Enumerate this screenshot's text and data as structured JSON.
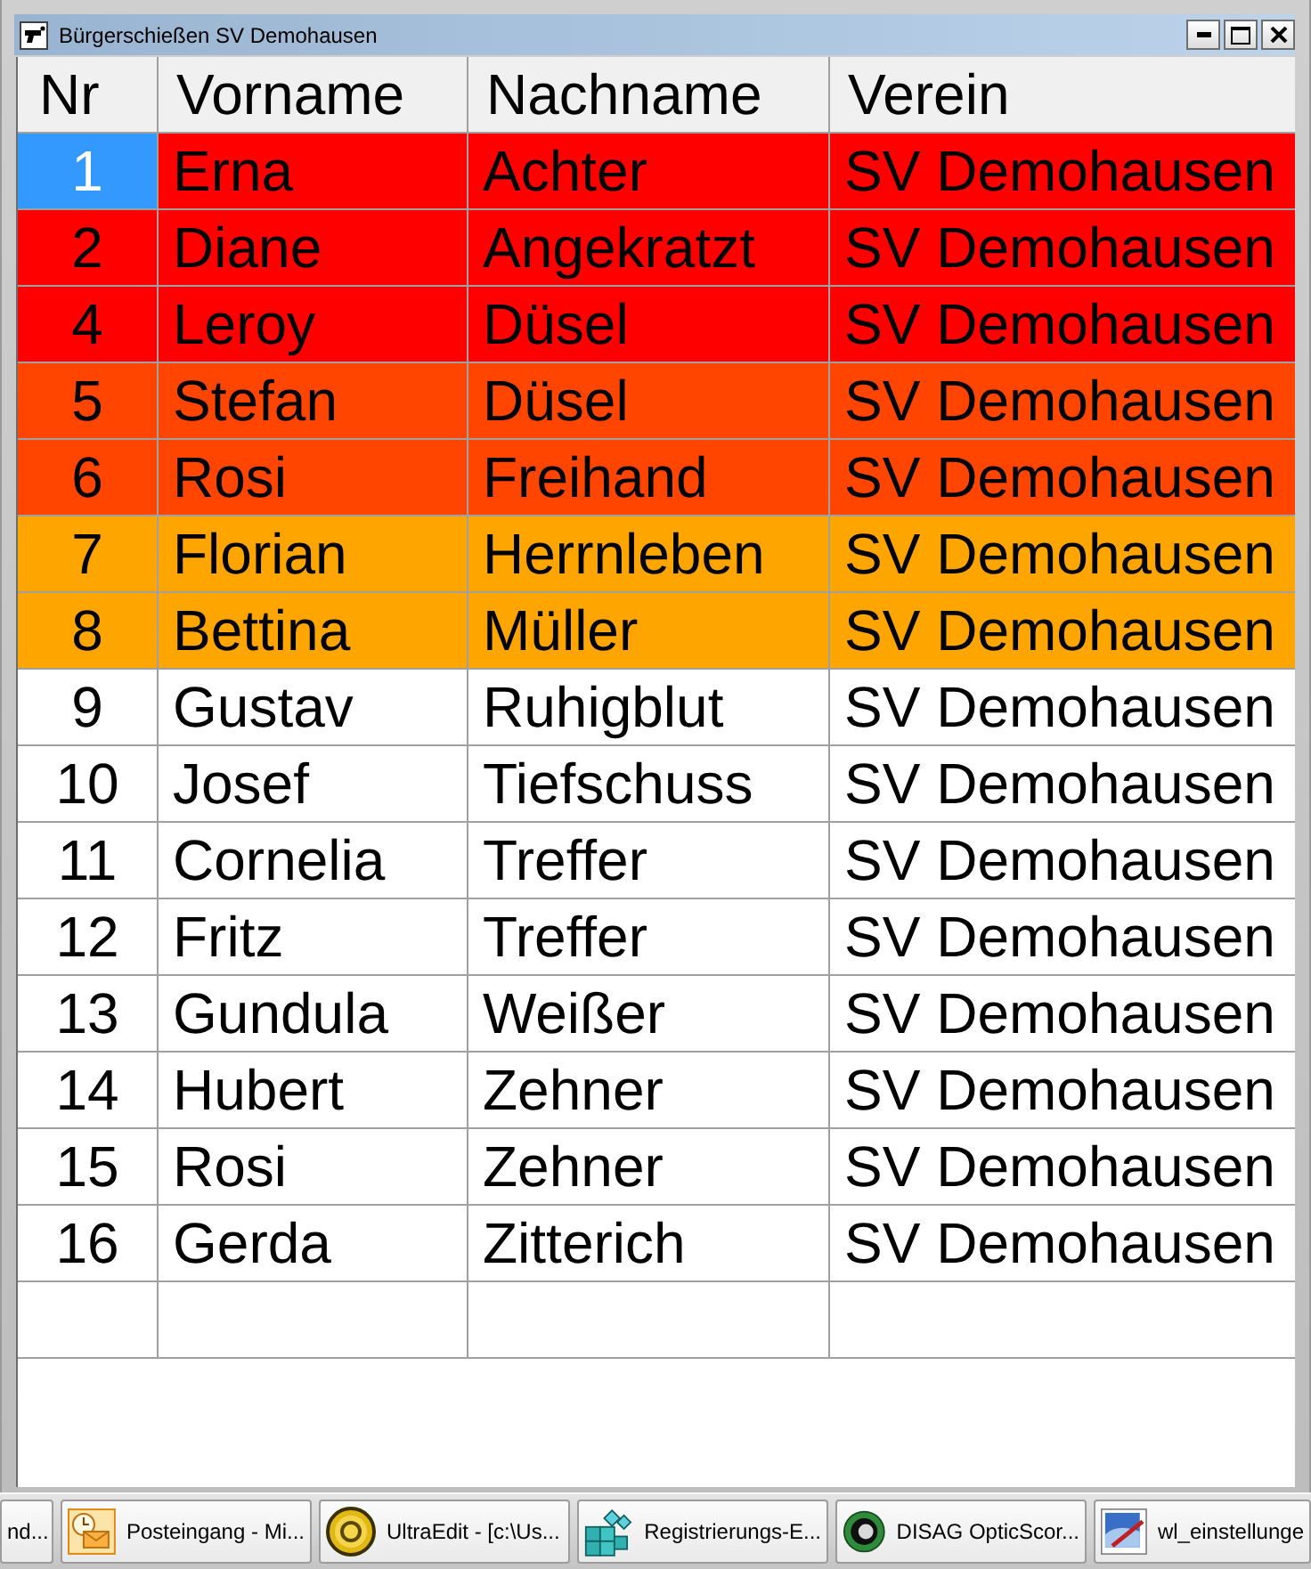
{
  "window": {
    "title": "Bürgerschießen SV Demohausen"
  },
  "table": {
    "columns": [
      "Nr",
      "Vorname",
      "Nachname",
      "Verein"
    ],
    "rows": [
      {
        "nr": "1",
        "first_name": "Erna",
        "last_name": "Achter",
        "club": "SV Demohausen",
        "color": "#ff0000",
        "selected": true
      },
      {
        "nr": "2",
        "first_name": "Diane",
        "last_name": "Angekratzt",
        "club": "SV Demohausen",
        "color": "#ff0000",
        "selected": false
      },
      {
        "nr": "4",
        "first_name": "Leroy",
        "last_name": "Düsel",
        "club": "SV Demohausen",
        "color": "#ff0000",
        "selected": false
      },
      {
        "nr": "5",
        "first_name": "Stefan",
        "last_name": "Düsel",
        "club": "SV Demohausen",
        "color": "#ff4500",
        "selected": false
      },
      {
        "nr": "6",
        "first_name": "Rosi",
        "last_name": "Freihand",
        "club": "SV Demohausen",
        "color": "#ff4500",
        "selected": false
      },
      {
        "nr": "7",
        "first_name": "Florian",
        "last_name": "Herrnleben",
        "club": "SV Demohausen",
        "color": "#ffa500",
        "selected": false
      },
      {
        "nr": "8",
        "first_name": "Bettina",
        "last_name": "Müller",
        "club": "SV Demohausen",
        "color": "#ffa500",
        "selected": false
      },
      {
        "nr": "9",
        "first_name": "Gustav",
        "last_name": "Ruhigblut",
        "club": "SV Demohausen",
        "color": "#ffffff",
        "selected": false
      },
      {
        "nr": "10",
        "first_name": "Josef",
        "last_name": "Tiefschuss",
        "club": "SV Demohausen",
        "color": "#ffffff",
        "selected": false
      },
      {
        "nr": "11",
        "first_name": "Cornelia",
        "last_name": "Treffer",
        "club": "SV Demohausen",
        "color": "#ffffff",
        "selected": false
      },
      {
        "nr": "12",
        "first_name": "Fritz",
        "last_name": "Treffer",
        "club": "SV Demohausen",
        "color": "#ffffff",
        "selected": false
      },
      {
        "nr": "13",
        "first_name": "Gundula",
        "last_name": "Weißer",
        "club": "SV Demohausen",
        "color": "#ffffff",
        "selected": false
      },
      {
        "nr": "14",
        "first_name": "Hubert",
        "last_name": "Zehner",
        "club": "SV Demohausen",
        "color": "#ffffff",
        "selected": false
      },
      {
        "nr": "15",
        "first_name": "Rosi",
        "last_name": "Zehner",
        "club": "SV Demohausen",
        "color": "#ffffff",
        "selected": false
      },
      {
        "nr": "16",
        "first_name": "Gerda",
        "last_name": "Zitterich",
        "club": "SV Demohausen",
        "color": "#ffffff",
        "selected": false
      }
    ]
  },
  "taskbar": {
    "items": [
      {
        "kind": "plain",
        "label": "nd..."
      },
      {
        "kind": "mail",
        "label": "Posteingang - Mi..."
      },
      {
        "kind": "editor",
        "label": "UltraEdit - [c:\\Us..."
      },
      {
        "kind": "registry",
        "label": "Registrierungs-E..."
      },
      {
        "kind": "disc",
        "label": "DISAG OpticScor..."
      },
      {
        "kind": "image",
        "label": "wl_einstellunge"
      }
    ]
  }
}
